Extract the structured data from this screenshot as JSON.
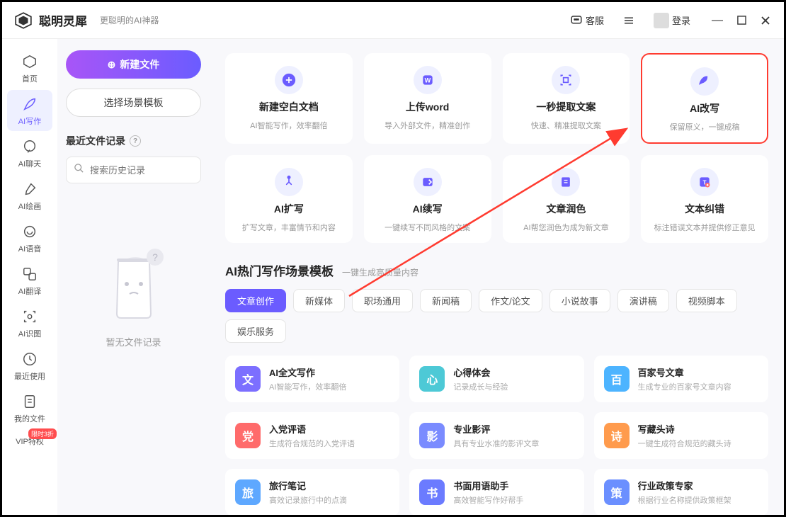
{
  "header": {
    "app_name": "聪明灵犀",
    "tagline": "更聪明的AI神器",
    "support": "客服",
    "login": "登录"
  },
  "sidebar": {
    "items": [
      {
        "label": "首页"
      },
      {
        "label": "AI写作"
      },
      {
        "label": "AI聊天"
      },
      {
        "label": "AI绘画"
      },
      {
        "label": "AI语音"
      },
      {
        "label": "AI翻译"
      },
      {
        "label": "AI识图"
      },
      {
        "label": "最近使用"
      },
      {
        "label": "我的文件"
      },
      {
        "label": "VIP特权"
      }
    ],
    "vip_badge": "限时3折"
  },
  "left_panel": {
    "new_file": "新建文件",
    "choose_template": "选择场景模板",
    "recent_title": "最近文件记录",
    "search_placeholder": "搜索历史记录",
    "empty_text": "暂无文件记录"
  },
  "features": [
    {
      "title": "新建空白文档",
      "desc": "AI智能写作，效率翻倍",
      "icon": "plus"
    },
    {
      "title": "上传word",
      "desc": "导入外部文件，精准创作",
      "icon": "word"
    },
    {
      "title": "一秒提取文案",
      "desc": "快速、精准提取文案",
      "icon": "extract"
    },
    {
      "title": "AI改写",
      "desc": "保留原义，一键成稿",
      "icon": "rewrite",
      "highlight": true
    },
    {
      "title": "AI扩写",
      "desc": "扩写文章，丰富情节和内容",
      "icon": "expand"
    },
    {
      "title": "AI续写",
      "desc": "一键续写不同风格的文案",
      "icon": "continue"
    },
    {
      "title": "文章润色",
      "desc": "AI帮您润色为成为新文章",
      "icon": "polish"
    },
    {
      "title": "文本纠错",
      "desc": "标注错误文本并提供修正意见",
      "icon": "correct"
    }
  ],
  "section": {
    "title": "AI热门写作场景模板",
    "subtitle": "一键生成高质量内容"
  },
  "tabs": [
    "文章创作",
    "新媒体",
    "职场通用",
    "新闻稿",
    "作文/论文",
    "小说故事",
    "演讲稿",
    "视频脚本",
    "娱乐服务"
  ],
  "templates": [
    {
      "title": "AI全文写作",
      "desc": "AI智能写作，效率翻倍",
      "color": "#7c6fff"
    },
    {
      "title": "心得体会",
      "desc": "记录成长与经验",
      "color": "#4dc9d6"
    },
    {
      "title": "百家号文章",
      "desc": "生成专业的百家号文章内容",
      "color": "#4db4ff"
    },
    {
      "title": "入党评语",
      "desc": "生成符合规范的入党评语",
      "color": "#ff6b6b"
    },
    {
      "title": "专业影评",
      "desc": "具有专业水准的影评文章",
      "color": "#7a8bff"
    },
    {
      "title": "写藏头诗",
      "desc": "一键生成符合规范的藏头诗",
      "color": "#ff9b4d"
    },
    {
      "title": "旅行笔记",
      "desc": "高效记录旅行中的点滴",
      "color": "#5ea8ff"
    },
    {
      "title": "书面用语助手",
      "desc": "高效智能写作好帮手",
      "color": "#6b7bff"
    },
    {
      "title": "行业政策专家",
      "desc": "根据行业名称提供政策框架",
      "color": "#6b8fff"
    }
  ]
}
